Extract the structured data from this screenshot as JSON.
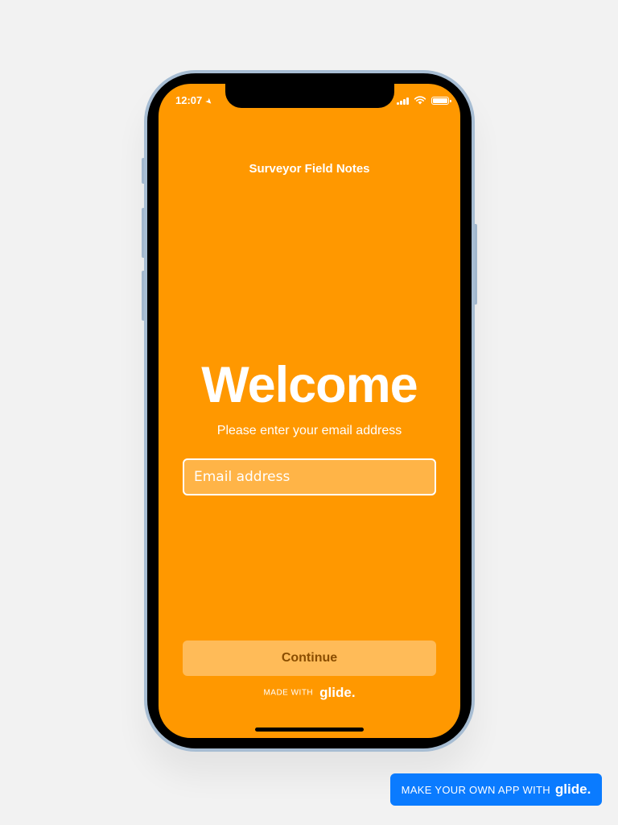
{
  "status_bar": {
    "time": "12:07"
  },
  "app": {
    "title": "Surveyor Field Notes"
  },
  "login": {
    "heading": "Welcome",
    "subtitle": "Please enter your email address",
    "email_placeholder": "Email address",
    "email_value": "",
    "continue_label": "Continue"
  },
  "footer": {
    "made_with": "MADE WITH",
    "brand": "glide."
  },
  "banner": {
    "text": "MAKE YOUR OWN APP WITH",
    "brand": "glide."
  },
  "colors": {
    "screen_bg": "#ff9800",
    "banner_bg": "#0a7bff",
    "phone_frame": "#a7bdd3"
  }
}
